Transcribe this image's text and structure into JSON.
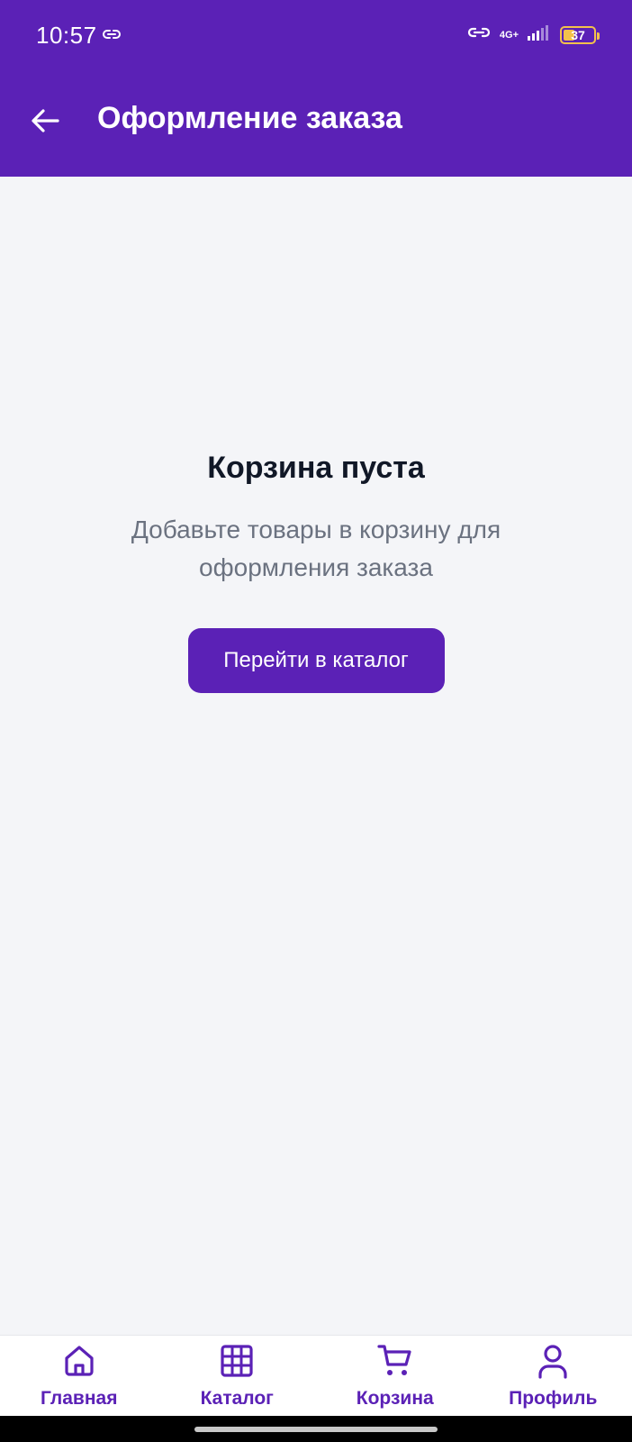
{
  "status_bar": {
    "time": "10:57",
    "network": "4G+",
    "battery": "37",
    "battery_level": 0.37
  },
  "app_bar": {
    "title": "Оформление заказа",
    "back_icon": "arrow-left-icon"
  },
  "empty_state": {
    "title": "Корзина пуста",
    "text": "Добавьте товары в корзину для оформления заказа",
    "button_label": "Перейти в каталог"
  },
  "bottom_nav": {
    "items": [
      {
        "label": "Главная",
        "icon": "home-icon"
      },
      {
        "label": "Каталог",
        "icon": "grid-icon"
      },
      {
        "label": "Корзина",
        "icon": "cart-icon"
      },
      {
        "label": "Профиль",
        "icon": "user-icon"
      }
    ]
  },
  "colors": {
    "primary": "#5b21b6",
    "background": "#f4f5f8",
    "text_dark": "#111827",
    "text_muted": "#6b7280"
  }
}
